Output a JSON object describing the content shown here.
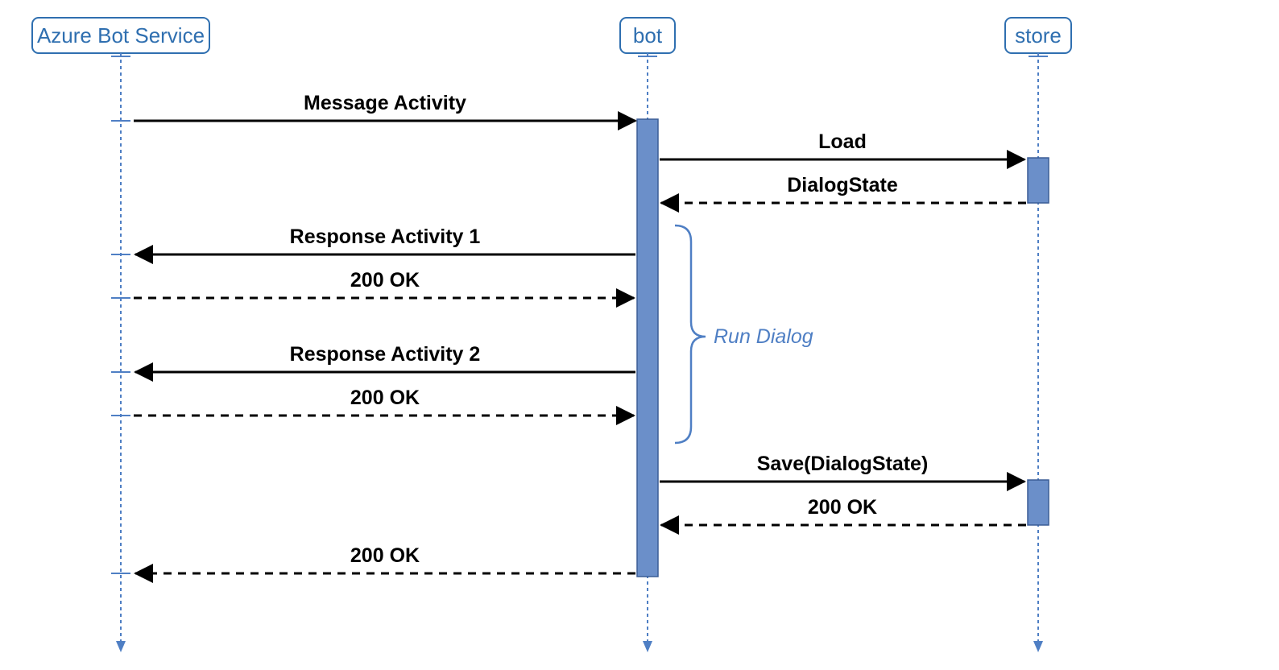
{
  "actors": {
    "azure": {
      "label": "Azure Bot Service"
    },
    "bot": {
      "label": "bot"
    },
    "store": {
      "label": "store"
    }
  },
  "messages": {
    "msg_activity": "Message Activity",
    "load": "Load",
    "dialog_state": "DialogState",
    "resp1": "Response Activity 1",
    "ok1": "200 OK",
    "resp2": "Response Activity 2",
    "ok2": "200 OK",
    "save": "Save(DialogState)",
    "ok_save": "200 OK",
    "ok_final": "200 OK"
  },
  "note": {
    "run_dialog": "Run Dialog"
  },
  "chart_data": {
    "type": "sequence-diagram",
    "actors": [
      "Azure Bot Service",
      "bot",
      "store"
    ],
    "interactions": [
      {
        "from": "Azure Bot Service",
        "to": "bot",
        "label": "Message Activity",
        "style": "solid"
      },
      {
        "from": "bot",
        "to": "store",
        "label": "Load",
        "style": "solid"
      },
      {
        "from": "store",
        "to": "bot",
        "label": "DialogState",
        "style": "dashed"
      },
      {
        "from": "bot",
        "to": "Azure Bot Service",
        "label": "Response Activity 1",
        "style": "solid"
      },
      {
        "from": "Azure Bot Service",
        "to": "bot",
        "label": "200 OK",
        "style": "dashed"
      },
      {
        "from": "bot",
        "to": "Azure Bot Service",
        "label": "Response Activity 2",
        "style": "solid"
      },
      {
        "from": "Azure Bot Service",
        "to": "bot",
        "label": "200 OK",
        "style": "dashed"
      },
      {
        "from": "bot",
        "to": "store",
        "label": "Save(DialogState)",
        "style": "solid"
      },
      {
        "from": "store",
        "to": "bot",
        "label": "200 OK",
        "style": "dashed"
      },
      {
        "from": "bot",
        "to": "Azure Bot Service",
        "label": "200 OK",
        "style": "dashed"
      }
    ],
    "note": {
      "on": "bot",
      "text": "Run Dialog",
      "span": "Response Activity 1 .. 200 OK (second)"
    }
  }
}
